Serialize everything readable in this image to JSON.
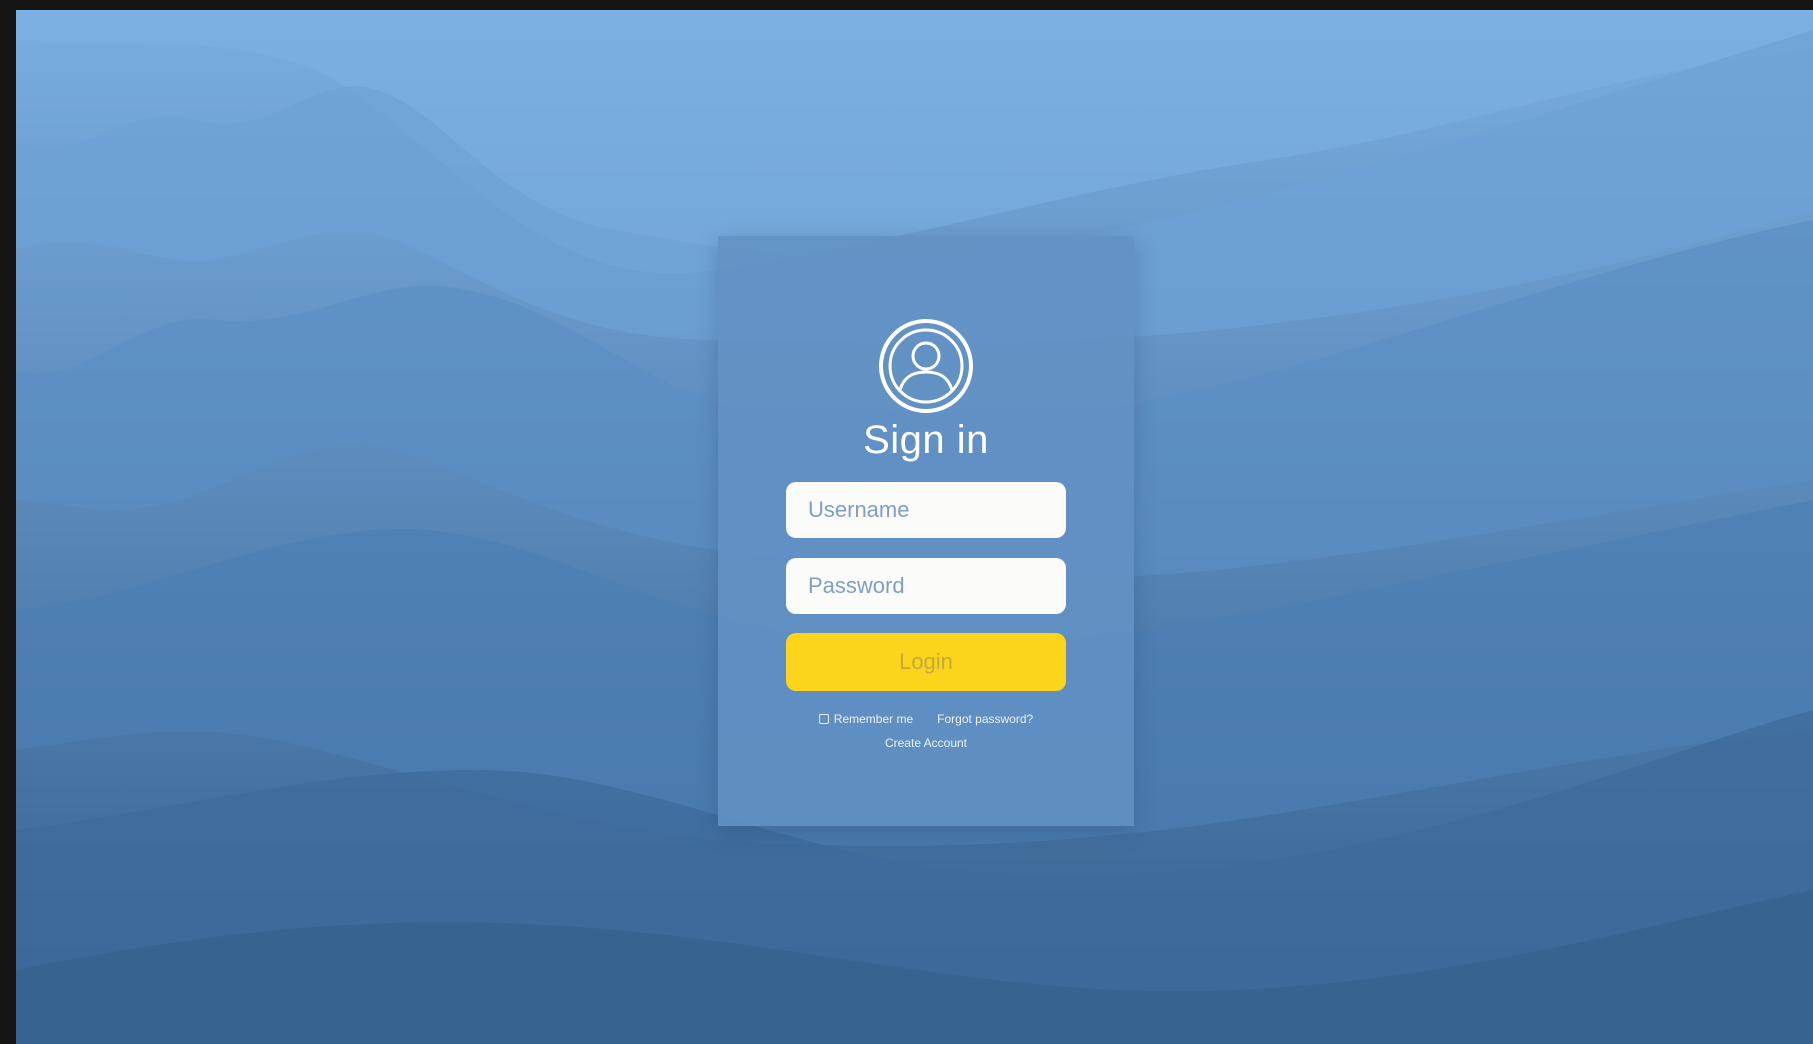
{
  "login_card": {
    "title": "Sign in",
    "username_placeholder": "Username",
    "password_placeholder": "Password",
    "login_label": "Login",
    "remember_label": "Remember me",
    "forgot_label": "Forgot password?",
    "create_label": "Create Account",
    "avatar_icon": "user-circle-icon"
  },
  "colors": {
    "background": "#3f6f9e",
    "card": "#6292c4",
    "button": "#fbd51c",
    "input": "#fbfcf9"
  }
}
